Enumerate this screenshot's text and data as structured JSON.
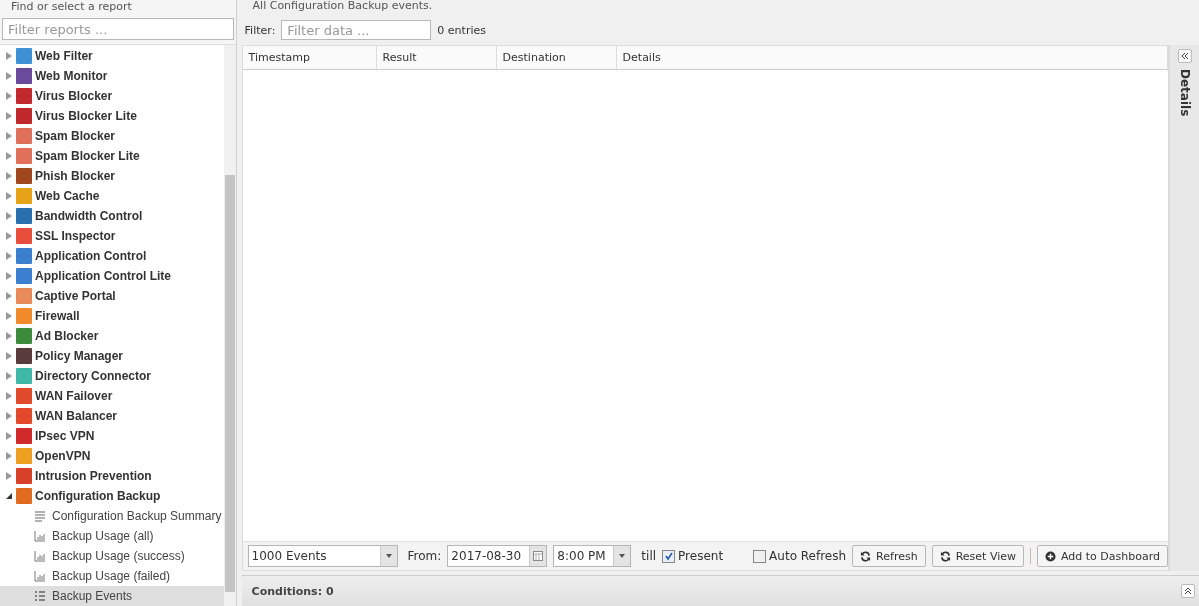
{
  "sidebar": {
    "title": "Find or select a report",
    "filter": {
      "placeholder": "Filter reports ..."
    },
    "items": [
      {
        "label": "Web Filter",
        "color": "#3d8fd6",
        "expanded": false
      },
      {
        "label": "Web Monitor",
        "color": "#6a4a9c",
        "expanded": false
      },
      {
        "label": "Virus Blocker",
        "color": "#c0282d",
        "expanded": false
      },
      {
        "label": "Virus Blocker Lite",
        "color": "#c0282d",
        "expanded": false
      },
      {
        "label": "Spam Blocker",
        "color": "#e0705a",
        "expanded": false
      },
      {
        "label": "Spam Blocker Lite",
        "color": "#e0705a",
        "expanded": false
      },
      {
        "label": "Phish Blocker",
        "color": "#a0461e",
        "expanded": false
      },
      {
        "label": "Web Cache",
        "color": "#e8a21a",
        "expanded": false
      },
      {
        "label": "Bandwidth Control",
        "color": "#2a6fb0",
        "expanded": false
      },
      {
        "label": "SSL Inspector",
        "color": "#e94e3c",
        "expanded": false
      },
      {
        "label": "Application Control",
        "color": "#3a7fd0",
        "expanded": false
      },
      {
        "label": "Application Control Lite",
        "color": "#3a7fd0",
        "expanded": false
      },
      {
        "label": "Captive Portal",
        "color": "#e98a5a",
        "expanded": false
      },
      {
        "label": "Firewall",
        "color": "#f08a2a",
        "expanded": false
      },
      {
        "label": "Ad Blocker",
        "color": "#3c8b3a",
        "expanded": false
      },
      {
        "label": "Policy Manager",
        "color": "#5a3a3a",
        "expanded": false
      },
      {
        "label": "Directory Connector",
        "color": "#3fb8a8",
        "expanded": false
      },
      {
        "label": "WAN Failover",
        "color": "#e04a2a",
        "expanded": false
      },
      {
        "label": "WAN Balancer",
        "color": "#e04a2a",
        "expanded": false
      },
      {
        "label": "IPsec VPN",
        "color": "#d02a2a",
        "expanded": false
      },
      {
        "label": "OpenVPN",
        "color": "#f0a020",
        "expanded": false
      },
      {
        "label": "Intrusion Prevention",
        "color": "#d8402a",
        "expanded": false
      },
      {
        "label": "Configuration Backup",
        "color": "#e06a20",
        "expanded": true,
        "children": [
          {
            "label": "Configuration Backup Summary",
            "kind": "summary",
            "selected": false
          },
          {
            "label": "Backup Usage (all)",
            "kind": "chart",
            "selected": false
          },
          {
            "label": "Backup Usage (success)",
            "kind": "chart",
            "selected": false
          },
          {
            "label": "Backup Usage (failed)",
            "kind": "chart",
            "selected": false
          },
          {
            "label": "Backup Events",
            "kind": "list",
            "selected": true
          }
        ]
      }
    ]
  },
  "report": {
    "description": "All Configuration Backup events.",
    "filter_label": "Filter:",
    "filter": {
      "placeholder": "Filter data ..."
    },
    "entries": "0 entries",
    "columns": [
      "Timestamp",
      "Result",
      "Destination",
      "Details"
    ],
    "toolbar": {
      "limit": "1000 Events",
      "from_label": "From:",
      "date": "2017-08-30",
      "time": "8:00 PM",
      "till_label": "till",
      "present": {
        "label": "Present",
        "checked": true
      },
      "auto_refresh": {
        "label": "Auto Refresh",
        "checked": false
      },
      "buttons": [
        "Refresh",
        "Reset View"
      ],
      "dashboard_button": "Add to Dashboard"
    },
    "conditions": "Conditions: 0"
  },
  "details_panel": {
    "title": "Details"
  }
}
